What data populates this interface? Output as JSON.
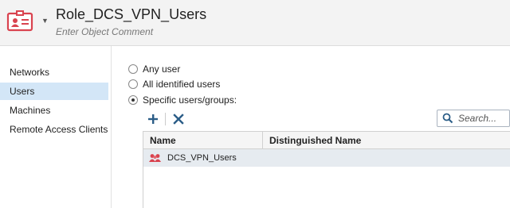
{
  "object": {
    "title": "Role_DCS_VPN_Users",
    "comment_placeholder": "Enter Object Comment",
    "icon": "role-card-icon",
    "accent_color": "#d9434f"
  },
  "nav": {
    "items": [
      {
        "label": "Networks",
        "active": false
      },
      {
        "label": "Users",
        "active": true
      },
      {
        "label": "Machines",
        "active": false
      },
      {
        "label": "Remote Access Clients",
        "active": false
      }
    ]
  },
  "user_scope": {
    "options": [
      {
        "label": "Any user",
        "checked": false
      },
      {
        "label": "All identified users",
        "checked": false
      },
      {
        "label": "Specific users/groups:",
        "checked": true
      }
    ]
  },
  "toolbar": {
    "add_icon": "plus-icon",
    "remove_icon": "x-icon"
  },
  "search": {
    "placeholder": "Search..."
  },
  "table": {
    "columns": [
      "Name",
      "Distinguished Name"
    ],
    "rows": [
      {
        "name": "DCS_VPN_Users",
        "dn": "",
        "icon": "user-group-icon"
      }
    ]
  }
}
